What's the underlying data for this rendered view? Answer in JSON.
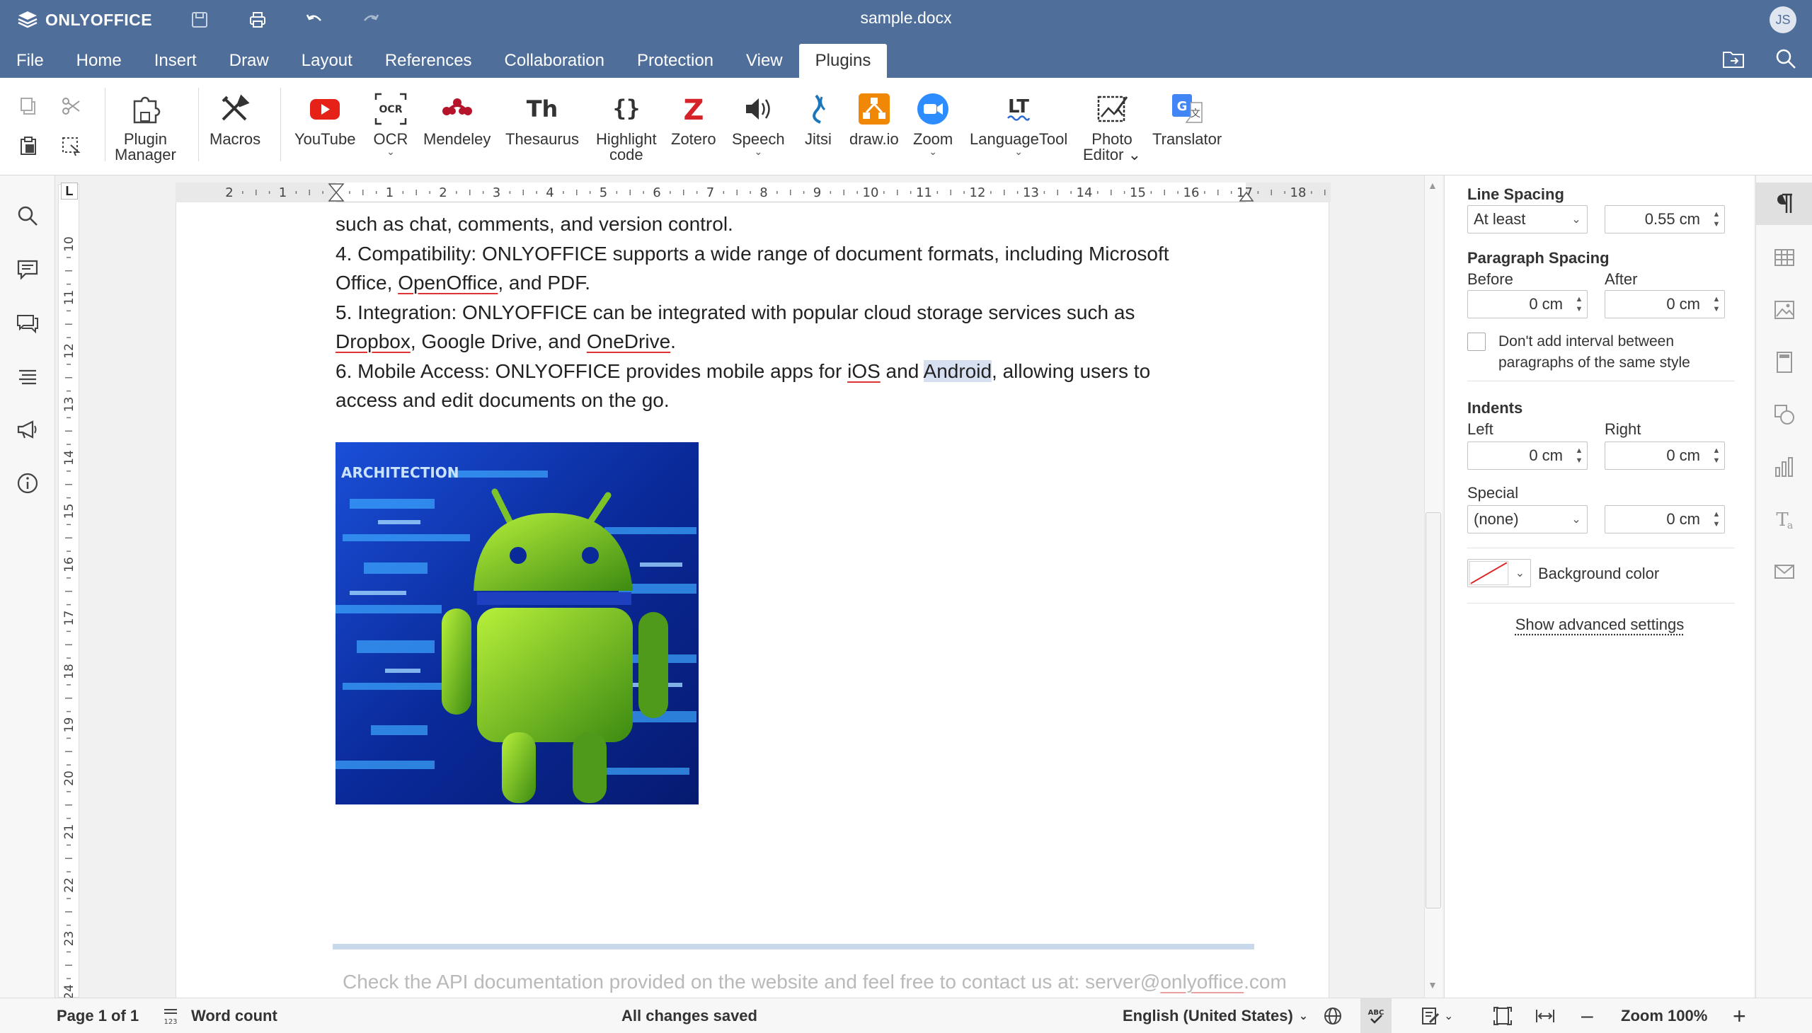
{
  "app": {
    "brand": "ONLYOFFICE",
    "doc_title": "sample.docx",
    "user_initials": "JS"
  },
  "menu_tabs": [
    "File",
    "Home",
    "Insert",
    "Draw",
    "Layout",
    "References",
    "Collaboration",
    "Protection",
    "View",
    "Plugins"
  ],
  "plugins": [
    {
      "label": "Plugin\nManager",
      "icon": "plugin-manager-icon"
    },
    {
      "label": "Macros",
      "icon": "macros-icon"
    },
    {
      "label": "YouTube",
      "icon": "youtube-icon"
    },
    {
      "label": "OCR",
      "icon": "ocr-icon",
      "dropdown": true
    },
    {
      "label": "Mendeley",
      "icon": "mendeley-icon"
    },
    {
      "label": "Thesaurus",
      "icon": "thesaurus-icon"
    },
    {
      "label": "Highlight\ncode",
      "icon": "highlight-code-icon"
    },
    {
      "label": "Zotero",
      "icon": "zotero-icon"
    },
    {
      "label": "Speech",
      "icon": "speech-icon",
      "dropdown": true
    },
    {
      "label": "Jitsi",
      "icon": "jitsi-icon"
    },
    {
      "label": "draw.io",
      "icon": "drawio-icon"
    },
    {
      "label": "Zoom",
      "icon": "zoom-icon",
      "dropdown": true
    },
    {
      "label": "LanguageTool",
      "icon": "languagetool-icon",
      "dropdown": true
    },
    {
      "label": "Photo\nEditor ⌄",
      "icon": "photo-editor-icon"
    },
    {
      "label": "Translator",
      "icon": "translator-icon"
    }
  ],
  "document": {
    "lines": {
      "l1": "such as chat, comments, and version control.",
      "l2a": "4. Compatibility: ONLYOFFICE supports a wide range of document formats, including Microsoft",
      "l3a": "Office, ",
      "l3b": "OpenOffice",
      "l3c": ", and PDF.",
      "l4a": "5. Integration: ONLYOFFICE can be integrated with popular cloud storage services such as",
      "l5a": "Dropbox",
      "l5b": ", Google Drive, and ",
      "l5c": "OneDrive",
      "l5d": ".",
      "l6a": "6. Mobile Access: ONLYOFFICE provides mobile apps for ",
      "l6b": "iOS",
      "l6c": " and ",
      "l6d": "Android",
      "l6e": ", allowing users to",
      "l7a": "access and edit documents on the go."
    },
    "image_caption": "ARCHITECTION",
    "footer": {
      "text": "Check the API documentation provided on the website and feel free to contact us at: ",
      "email_a": "server@",
      "email_b": "onlyoffice",
      "email_c": ".com"
    }
  },
  "ruler": {
    "h_labels": [
      "2",
      "1",
      "1",
      "2",
      "3",
      "4",
      "5",
      "6",
      "7",
      "8",
      "9",
      "10",
      "11",
      "12",
      "13",
      "14",
      "15",
      "16",
      "17",
      "18"
    ],
    "v_labels": [
      "10",
      "11",
      "12",
      "13",
      "14",
      "15",
      "16",
      "17",
      "18",
      "19",
      "20",
      "21",
      "22",
      "23",
      "24"
    ],
    "corner": "L"
  },
  "panel": {
    "line_spacing_title": "Line Spacing",
    "line_spacing_mode": "At least",
    "line_spacing_value": "0.55 cm",
    "paragraph_spacing_title": "Paragraph Spacing",
    "before_label": "Before",
    "before_value": "0 cm",
    "after_label": "After",
    "after_value": "0 cm",
    "no_interval_label": "Don't add interval between\nparagraphs of the same style",
    "indents_title": "Indents",
    "left_label": "Left",
    "left_value": "0 cm",
    "right_label": "Right",
    "right_value": "0 cm",
    "special_label": "Special",
    "special_mode": "(none)",
    "special_value": "0 cm",
    "background_color_label": "Background color",
    "advanced_link": "Show advanced settings"
  },
  "status": {
    "page": "Page 1 of 1",
    "word_count": "Word count",
    "saved": "All changes saved",
    "language": "English (United States)",
    "zoom": "Zoom 100%"
  },
  "colors": {
    "header": "#4f6e99",
    "spell_underline": "#dd3333",
    "selection": "#d6e0f0"
  }
}
